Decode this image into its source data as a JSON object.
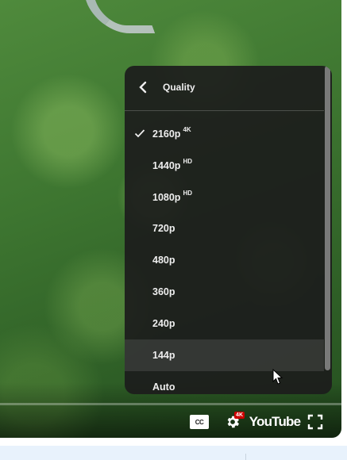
{
  "menu": {
    "title": "Quality",
    "items": [
      {
        "label": "2160p",
        "sup": "4K",
        "selected": true
      },
      {
        "label": "1440p",
        "sup": "HD",
        "selected": false
      },
      {
        "label": "1080p",
        "sup": "HD",
        "selected": false
      },
      {
        "label": "720p",
        "sup": "",
        "selected": false
      },
      {
        "label": "480p",
        "sup": "",
        "selected": false
      },
      {
        "label": "360p",
        "sup": "",
        "selected": false
      },
      {
        "label": "240p",
        "sup": "",
        "selected": false
      },
      {
        "label": "144p",
        "sup": "",
        "selected": false,
        "hovered": true
      },
      {
        "label": "Auto",
        "sup": "",
        "selected": false
      }
    ]
  },
  "controls": {
    "cc_label": "CC",
    "settings_badge": "4K",
    "logo_text": "YouTube"
  },
  "colors": {
    "menu_bg": "#1c1c1c",
    "badge_red": "#cc0000"
  }
}
